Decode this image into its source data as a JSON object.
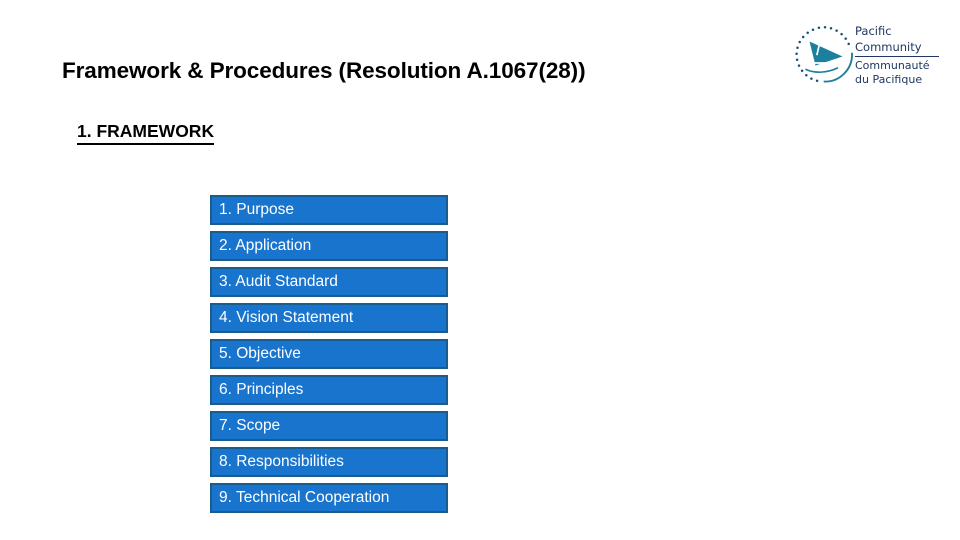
{
  "slide": {
    "title": "Framework & Procedures (Resolution A.1067(28))",
    "section_heading": "1. FRAMEWORK",
    "background_color": "#FFFFFF",
    "title_color": "#000000"
  },
  "logo": {
    "name": "pacific-community-logo",
    "english_line1": "Pacific",
    "english_line2": "Community",
    "french_line1": "Communauté",
    "french_line2": "du Pacifique",
    "mark_color": "#1B7F9E",
    "text_color": "#1F3864"
  },
  "list": {
    "accent_fill": "#1874CD",
    "accent_border": "#1A5D8C",
    "text_color": "#FFFFFF",
    "items": [
      {
        "label": "1. Purpose"
      },
      {
        "label": "2. Application"
      },
      {
        "label": "3. Audit Standard"
      },
      {
        "label": "4. Vision Statement"
      },
      {
        "label": "5. Objective"
      },
      {
        "label": "6. Principles"
      },
      {
        "label": "7. Scope"
      },
      {
        "label": "8. Responsibilities"
      },
      {
        "label": "9. Technical Cooperation"
      }
    ]
  }
}
